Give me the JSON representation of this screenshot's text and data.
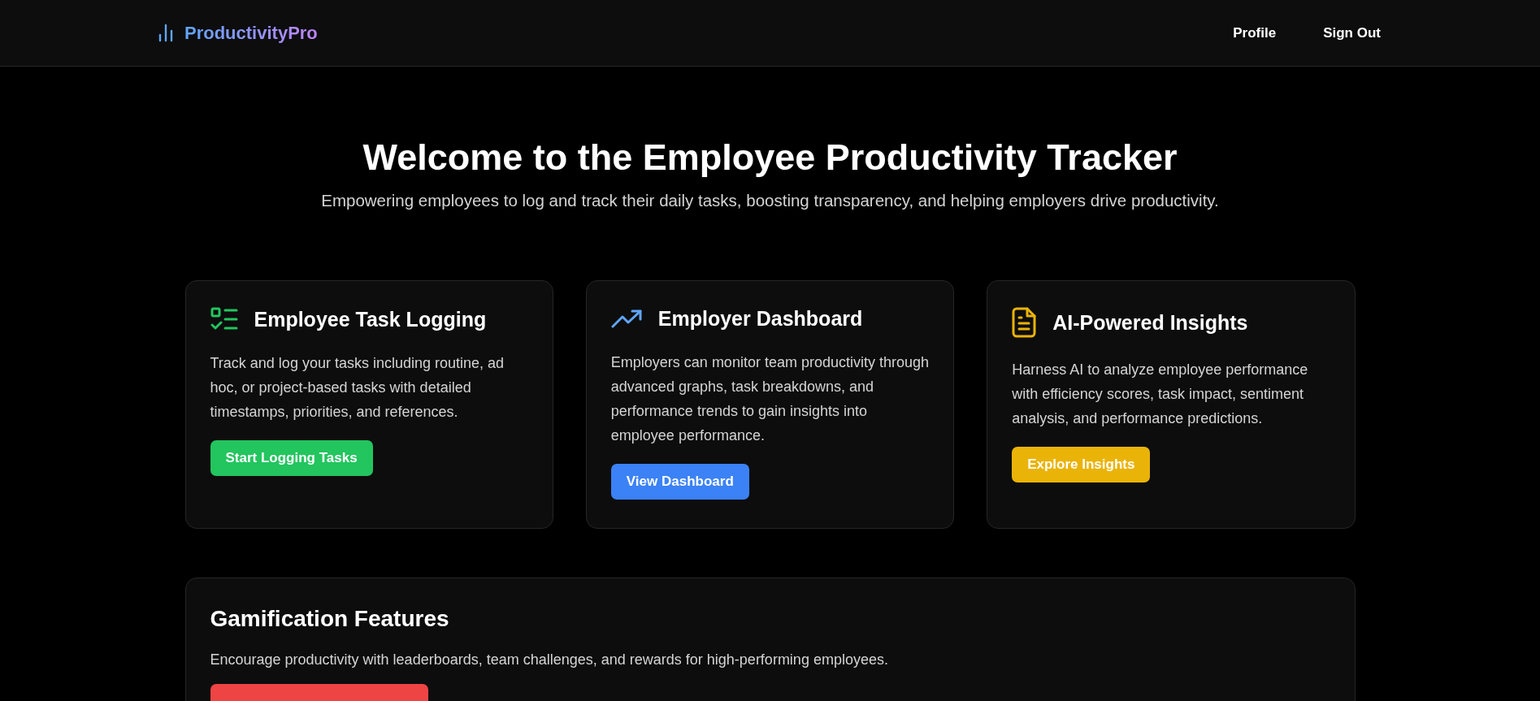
{
  "header": {
    "brand": "ProductivityPro",
    "links": [
      "Profile",
      "Sign Out"
    ]
  },
  "hero": {
    "title": "Welcome to the Employee Productivity Tracker",
    "subtitle": "Empowering employees to log and track their daily tasks, boosting transparency, and helping employers drive productivity."
  },
  "features": [
    {
      "kind": "checklist",
      "title": "Employee Task Logging",
      "text": "Track and log your tasks including routine, ad hoc, or project-based tasks with detailed timestamps, priorities, and references.",
      "button": "Start Logging Tasks",
      "color": "#22c55e"
    },
    {
      "kind": "trend",
      "title": "Employer Dashboard",
      "text": "Employers can monitor team productivity through advanced graphs, task breakdowns, and performance trends to gain insights into employee performance.",
      "button": "View Dashboard",
      "color": "#3b82f6"
    },
    {
      "kind": "document",
      "title": "AI-Powered Insights",
      "text": "Harness AI to analyze employee performance with efficiency scores, task impact, sentiment analysis, and performance predictions.",
      "button": "Explore Insights",
      "color": "#eab308"
    }
  ],
  "gamification": {
    "title": "Gamification Features",
    "text": "Encourage productivity with leaderboards, team challenges, and rewards for high-performing employees.",
    "button": {
      "kind": "danger"
    }
  }
}
